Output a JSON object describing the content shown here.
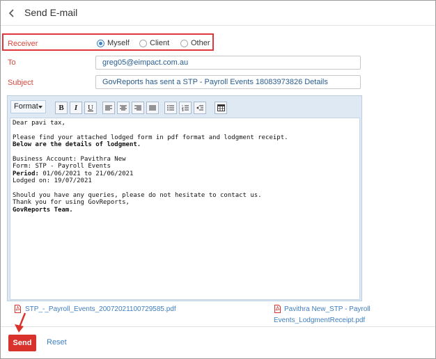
{
  "header": {
    "title": "Send E-mail",
    "back_icon": "chevron-left-icon"
  },
  "form": {
    "receiver_label": "Receiver",
    "receiver_options": [
      {
        "label": "Myself",
        "selected": true
      },
      {
        "label": "Client",
        "selected": false
      },
      {
        "label": "Other",
        "selected": false
      }
    ],
    "to_label": "To",
    "to_value": "greg05@eimpact.com.au",
    "subject_label": "Subject",
    "subject_value": "GovReports has sent a STP - Payroll Events 18083973826 Details"
  },
  "editor": {
    "format_label": "Format",
    "toolbar": [
      "bold-icon",
      "italic-icon",
      "underline-icon",
      "align-left-icon",
      "align-center-icon",
      "align-right-icon",
      "justify-icon",
      "bullet-list-icon",
      "numbered-list-icon",
      "remove-format-icon",
      "table-icon"
    ],
    "bold_label": "B",
    "italic_label": "I",
    "underline_label": "U",
    "body": {
      "greeting": "Dear pavi tax,",
      "intro": "Please find your attached lodged form in pdf format and lodgment receipt.",
      "details_heading": "Below are the details of lodgment.",
      "business_account": "Business Account: Pavithra New",
      "form": "Form: STP - Payroll Events",
      "period_label": "Period:",
      "period_value": " 01/06/2021 to 21/06/2021",
      "lodged_on": "Lodged on: 19/07/2021",
      "queries": "Should you have any queries, please do not hesitate to contact us.",
      "thanks": "Thank you for using GovReports,",
      "signature": "GovReports Team."
    }
  },
  "attachments": [
    {
      "name": "STP_-_Payroll_Events_20072021100729585.pdf",
      "icon": "pdf-icon"
    },
    {
      "name_line1": "Pavithra New_STP - Payroll",
      "name_line2": "Events_LodgmentReceipt.pdf",
      "icon": "pdf-icon"
    }
  ],
  "actions": {
    "send_label": "Send",
    "reset_label": "Reset"
  },
  "colors": {
    "accent_red": "#d9312b",
    "link_blue": "#3f7fbf",
    "label_red": "#d9463d",
    "radio_blue": "#3c80c9",
    "editor_bg": "#dfe9f4"
  }
}
